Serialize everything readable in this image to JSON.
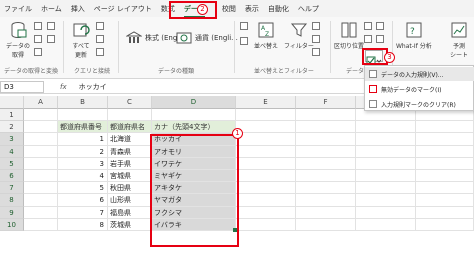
{
  "tabs": [
    "ファイル",
    "ホーム",
    "挿入",
    "ページ レイアウト",
    "数式",
    "データ",
    "校閲",
    "表示",
    "自動化",
    "ヘルプ"
  ],
  "active_tab": "データ",
  "ribbon": {
    "get_data": "データの\n取得",
    "refresh_all": "すべて\n更新",
    "stocks": "株式 (Engli...",
    "currency": "通貨 (Engli...",
    "sort": "並べ替え",
    "filter": "フィルター",
    "text_to_columns": "区切り位置",
    "what_if": "What-If 分析",
    "forecast": "予測\nシート",
    "group_get_transform": "データの取得と変換",
    "group_queries": "クエリと接続",
    "group_data_types": "データの種類",
    "group_sort_filter": "並べ替えとフィルター",
    "group_data_tools": "データ",
    "data_validation_icon": "data-validation-icon"
  },
  "formula_bar": {
    "name_box": "D3",
    "fx": "fx",
    "value": "ホッカイ"
  },
  "dropdown": {
    "items": [
      "データの入力規則(V)...",
      "無効データのマーク(I)",
      "入力規則マークのクリア(R)"
    ]
  },
  "badges": {
    "one": "1",
    "two": "2",
    "three": "3"
  },
  "sheet": {
    "columns": [
      "A",
      "B",
      "C",
      "D",
      "E",
      "F",
      "G",
      "H"
    ],
    "headers": [
      "都道府県番号",
      "都道府県名",
      "カナ（先頭4文字）"
    ],
    "rows": [
      {
        "n": "1",
        "name": "北海道",
        "kana": "ホッカイ"
      },
      {
        "n": "2",
        "name": "青森県",
        "kana": "アオモリ"
      },
      {
        "n": "3",
        "name": "岩手県",
        "kana": "イワテケ"
      },
      {
        "n": "4",
        "name": "宮城県",
        "kana": "ミヤギケ"
      },
      {
        "n": "5",
        "name": "秋田県",
        "kana": "アキタケ"
      },
      {
        "n": "6",
        "name": "山形県",
        "kana": "ヤマガタ"
      },
      {
        "n": "7",
        "name": "福島県",
        "kana": "フクシマ"
      },
      {
        "n": "8",
        "name": "茨城県",
        "kana": "イバラキ"
      }
    ]
  },
  "colors": {
    "accent": "#217346",
    "annotation": "#e60012",
    "header_fill": "#e2efda",
    "selection": "#d9d9d9"
  }
}
